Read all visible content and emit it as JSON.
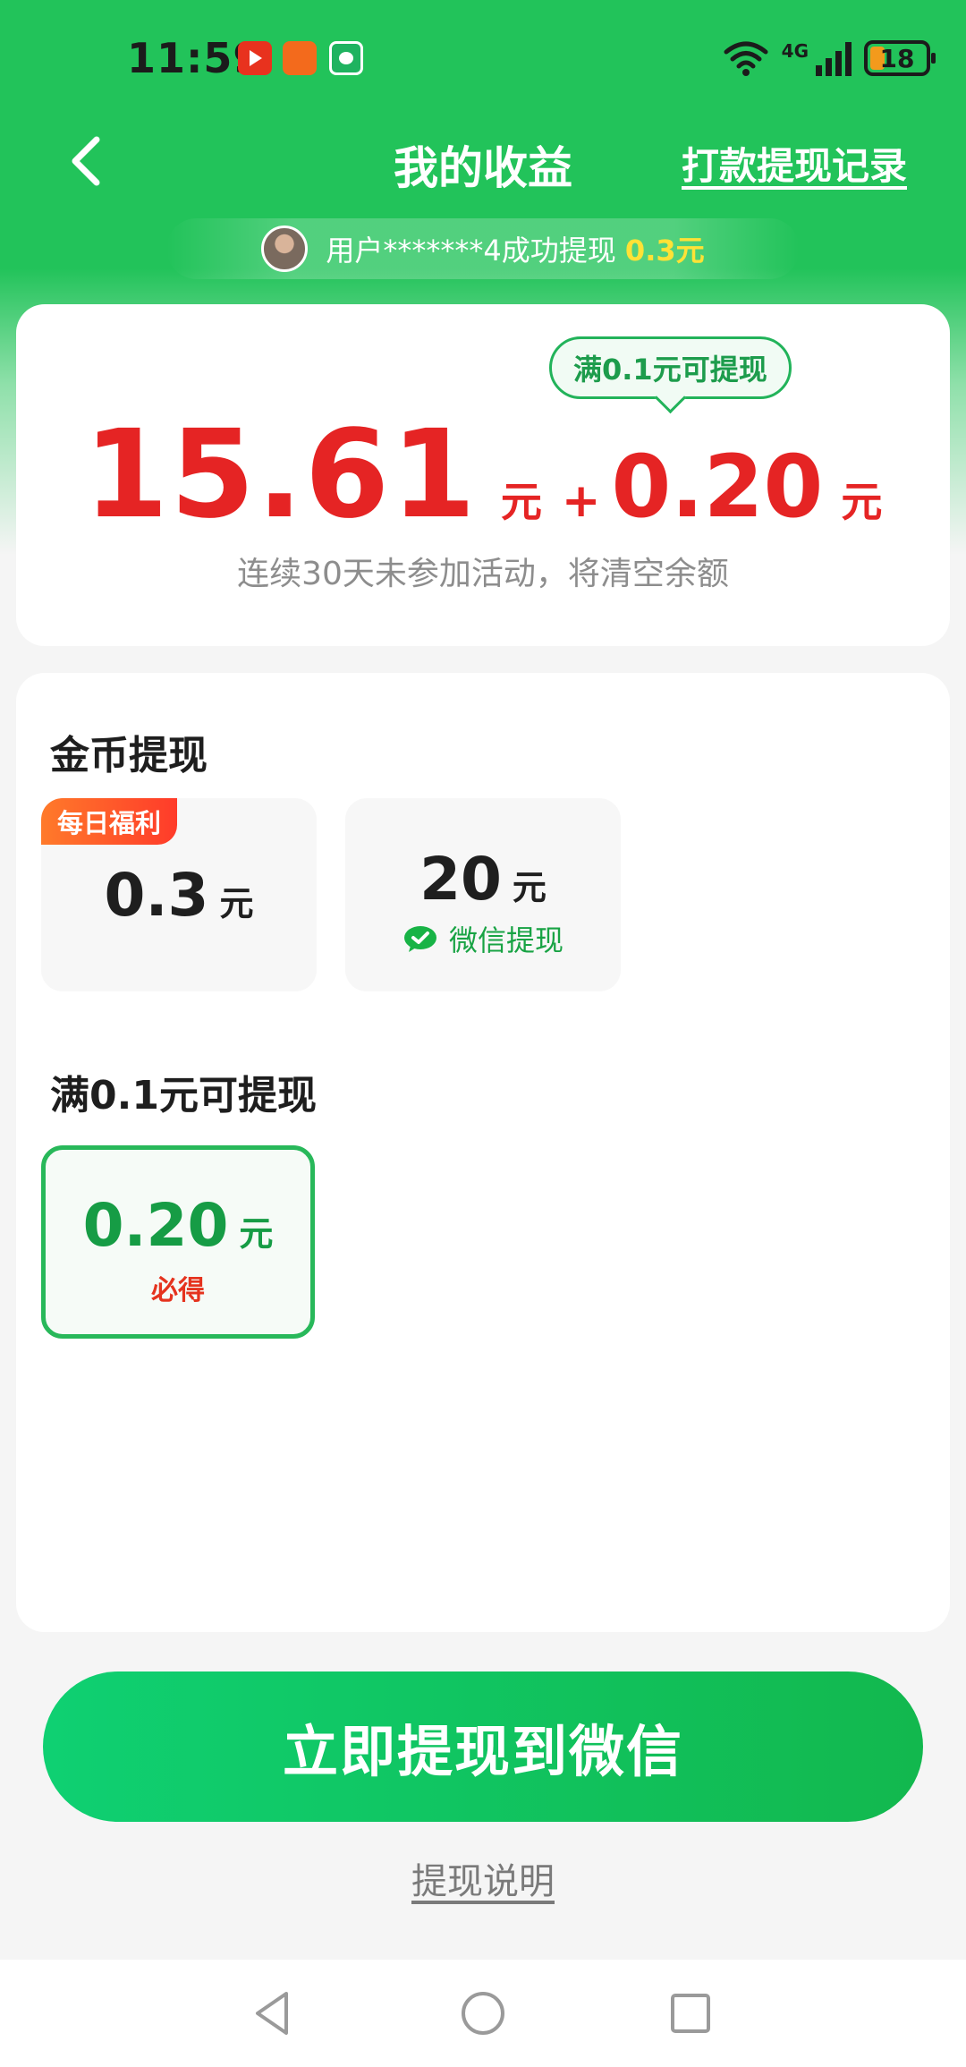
{
  "status_bar": {
    "time": "11:59",
    "network": "4G",
    "battery": "18"
  },
  "header": {
    "title": "我的收益",
    "records_link": "打款提现记录"
  },
  "ticker": {
    "text": "用户*******4成功提现",
    "amount": "0.3元"
  },
  "balance": {
    "bubble": "满0.1元可提现",
    "main_amount": "15.61",
    "main_unit": "元",
    "plus": "+",
    "bonus_amount": "0.20",
    "bonus_unit": "元",
    "note": "连续30天未参加活动，将清空余额"
  },
  "coin_withdraw": {
    "title": "金币提现",
    "options": [
      {
        "badge": "每日福利",
        "amount": "0.3",
        "unit": "元"
      },
      {
        "amount": "20",
        "unit": "元",
        "tag": "微信提现"
      }
    ]
  },
  "min_withdraw": {
    "title": "满0.1元可提现",
    "option": {
      "amount": "0.20",
      "unit": "元",
      "tag": "必得"
    }
  },
  "cta": {
    "label": "立即提现到微信"
  },
  "explain": {
    "label": "提现说明"
  },
  "colors": {
    "brand_green": "#22c35a",
    "amount_red": "#e52424",
    "wechat_green": "#18a344",
    "accent_yellow": "#ffe236"
  }
}
